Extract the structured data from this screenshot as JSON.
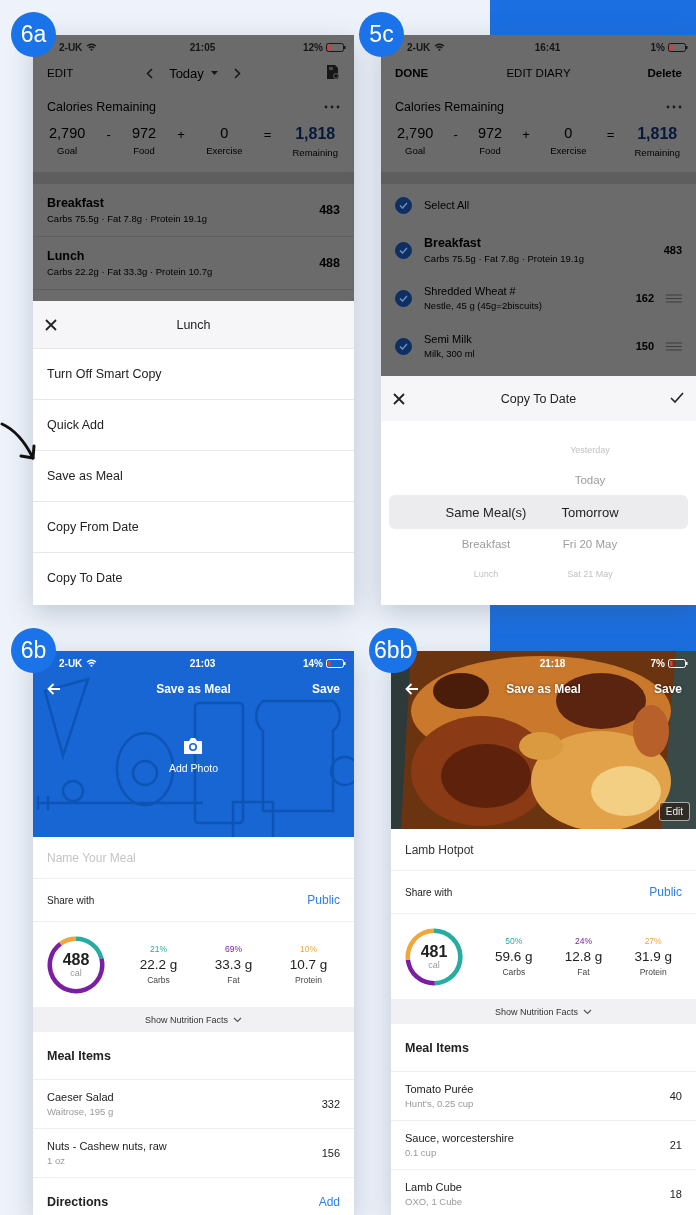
{
  "screens": [
    {
      "kind": "diary_sheet",
      "badge": "6a",
      "status_bar": {
        "carrier": "2-UK",
        "time": "21:05",
        "battery": "12%"
      },
      "nav": {
        "left": "EDIT",
        "title": "Today"
      },
      "summary": {
        "title": "Calories Remaining",
        "terms": [
          {
            "value": "2,790",
            "label": "Goal",
            "highlight": false
          },
          {
            "op": "-",
            "value": "972",
            "label": "Food",
            "highlight": false
          },
          {
            "op": "+",
            "value": "0",
            "label": "Exercise",
            "highlight": false
          },
          {
            "op": "=",
            "value": "1,818",
            "label": "Remaining",
            "highlight": true
          }
        ]
      },
      "meals": [
        {
          "name": "Breakfast",
          "detail": "Carbs 75.5g · Fat 7.8g · Protein 19.1g",
          "calories": "483"
        },
        {
          "name": "Lunch",
          "detail": "Carbs 22.2g · Fat 33.3g · Protein 10.7g",
          "calories": "488"
        }
      ],
      "sheet": {
        "title": "Lunch",
        "options": [
          "Turn Off Smart Copy",
          "Quick Add",
          "Save as Meal",
          "Copy From Date",
          "Copy To Date"
        ]
      }
    },
    {
      "kind": "edit_diary",
      "badge": "5c",
      "status_bar": {
        "carrier": "2-UK",
        "time": "16:41",
        "battery": "1%"
      },
      "nav": {
        "left": "DONE",
        "title": "EDIT DIARY",
        "right": "Delete"
      },
      "summary": {
        "title": "Calories Remaining",
        "terms": [
          {
            "value": "2,790",
            "label": "Goal",
            "highlight": false
          },
          {
            "op": "-",
            "value": "972",
            "label": "Food",
            "highlight": false
          },
          {
            "op": "+",
            "value": "0",
            "label": "Exercise",
            "highlight": false
          },
          {
            "op": "=",
            "value": "1,818",
            "label": "Remaining",
            "highlight": true
          }
        ]
      },
      "rows": [
        {
          "kind": "select_all",
          "name": "Select All",
          "checked": true
        },
        {
          "kind": "meal",
          "name": "Breakfast",
          "detail": "Carbs 75.5g · Fat 7.8g · Protein 19.1g",
          "calories": "483",
          "checked": true
        },
        {
          "kind": "food",
          "name": "Shredded Wheat #",
          "detail": "Nestle, 45 g (45g=2biscuits)",
          "calories": "162",
          "checked": true
        },
        {
          "kind": "food",
          "name": "Semi Milk",
          "detail": "Milk, 300 ml",
          "calories": "150",
          "checked": true
        }
      ],
      "sheet": {
        "title": "Copy To Date",
        "picker": [
          {
            "items": [
              {
                "label": "Same Meal(s)",
                "selected": true
              },
              {
                "label": "Breakfast",
                "selected": false
              },
              {
                "label": "Lunch",
                "selected": false
              }
            ]
          },
          {
            "items": [
              {
                "label": "Yesterday",
                "selected": false
              },
              {
                "label": "Today",
                "selected": false
              },
              {
                "label": "Tomorrow",
                "selected": true
              },
              {
                "label": "Fri 20 May",
                "selected": false
              },
              {
                "label": "Sat 21 May",
                "selected": false
              }
            ]
          }
        ]
      }
    },
    {
      "kind": "save_meal",
      "badge": "6b",
      "status_bar": {
        "carrier": "2-UK",
        "time": "21:03",
        "battery": "14%"
      },
      "nav": {
        "title": "Save as Meal",
        "right": "Save"
      },
      "header": {
        "kind": "pattern",
        "add_photo": "Add Photo"
      },
      "name_field": {
        "placeholder": "Name Your Meal"
      },
      "share": {
        "label": "Share with",
        "value": "Public"
      },
      "nutrition": {
        "calories": "488",
        "unit": "cal",
        "macros": [
          {
            "percent": "21%",
            "amount": "22.2 g",
            "name": "Carbs",
            "color": "#26ada0"
          },
          {
            "percent": "69%",
            "amount": "33.3 g",
            "name": "Fat",
            "color": "#7b1fa2"
          },
          {
            "percent": "10%",
            "amount": "10.7 g",
            "name": "Protein",
            "color": "#f0a63a"
          }
        ],
        "chart_data": {
          "type": "donut",
          "series": [
            {
              "values": [
                21,
                69,
                10
              ]
            }
          ]
        }
      },
      "facts_toggle": "Show Nutrition Facts",
      "items_title": "Meal Items",
      "items": [
        {
          "name": "Caeser Salad",
          "detail": "Waitrose, 195 g",
          "calories": "332"
        },
        {
          "name": "Nuts - Cashew nuts, raw",
          "detail": "1 oz",
          "calories": "156"
        }
      ],
      "directions": {
        "title": "Directions",
        "action": "Add"
      }
    },
    {
      "kind": "save_meal",
      "badge": "6bb",
      "status_bar": {
        "time": "21:18",
        "battery": "7%"
      },
      "nav": {
        "title": "Save as Meal",
        "right": "Save"
      },
      "header": {
        "edit": "Edit"
      },
      "name_field": {
        "value": "Lamb Hotpot"
      },
      "share": {
        "label": "Share with",
        "value": "Public"
      },
      "nutrition": {
        "calories": "481",
        "unit": "cal",
        "macros": [
          {
            "percent": "50%",
            "amount": "59.6 g",
            "name": "Carbs",
            "color": "#26ada0"
          },
          {
            "percent": "24%",
            "amount": "12.8 g",
            "name": "Fat",
            "color": "#7b1fa2"
          },
          {
            "percent": "27%",
            "amount": "31.9 g",
            "name": "Protein",
            "color": "#f0a63a"
          }
        ],
        "chart_data": {
          "type": "donut",
          "series": [
            {
              "values": [
                50,
                24,
                27
              ]
            }
          ]
        }
      },
      "facts_toggle": "Show Nutrition Facts",
      "items_title": "Meal Items",
      "items": [
        {
          "name": "Tomato Purée",
          "detail": "Hunt's, 0.25 cup",
          "calories": "40"
        },
        {
          "name": "Sauce, worcestershire",
          "detail": "0.1 cup",
          "calories": "21"
        },
        {
          "name": "Lamb Cube",
          "detail": "OXO, 1 Cube",
          "calories": "18"
        }
      ]
    }
  ]
}
